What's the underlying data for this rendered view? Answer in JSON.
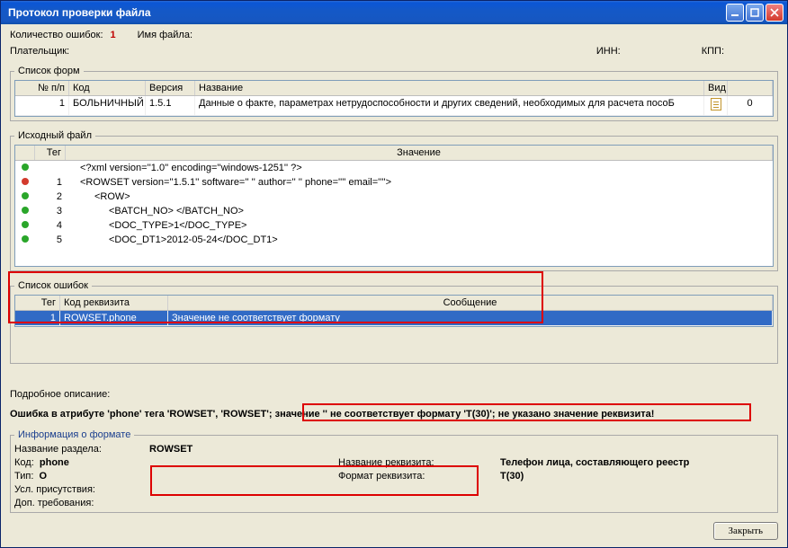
{
  "window": {
    "title": "Протокол проверки файла"
  },
  "summary": {
    "error_count_label": "Количество ошибок:",
    "error_count": "1",
    "file_name_label": "Имя файла:",
    "payer_label": "Плательщик:",
    "inn_label": "ИНН:",
    "kpp_label": "КПП:"
  },
  "forms": {
    "legend": "Список форм",
    "headers": {
      "num": "№ п/п",
      "code": "Код",
      "version": "Версия",
      "name": "Название",
      "vid": "Вид",
      "cnt": ""
    },
    "rows": [
      {
        "num": "1",
        "code": "БОЛЬНИЧНЫЙ",
        "version": "1.5.1",
        "name": "Данные о факте, параметрах нетрудоспособности и других сведений, необходимых для расчета посоБ",
        "cnt": "0"
      }
    ]
  },
  "source": {
    "legend": "Исходный файл",
    "headers": {
      "tag": "Тег",
      "value": "Значение"
    },
    "rows": [
      {
        "status": "green",
        "num": "",
        "text": "<?xml version=''1.0'' encoding=''windows-1251'' ?>",
        "indent": 1
      },
      {
        "status": "red",
        "num": "1",
        "text": "<ROWSET version=''1.5.1'' software=''                   '' author=''                                                   '' phone='''' email=''''>",
        "indent": 1
      },
      {
        "status": "green",
        "num": "2",
        "text": "<ROW>",
        "indent": 2
      },
      {
        "status": "green",
        "num": "3",
        "text": "<BATCH_NO>                                                </BATCH_NO>",
        "indent": 3
      },
      {
        "status": "green",
        "num": "4",
        "text": "<DOC_TYPE>1</DOC_TYPE>",
        "indent": 3
      },
      {
        "status": "green",
        "num": "5",
        "text": "<DOC_DT1>2012-05-24</DOC_DT1>",
        "indent": 3
      }
    ]
  },
  "errors": {
    "legend": "Список ошибок",
    "headers": {
      "tag": "Тег",
      "req": "Код реквизита",
      "msg": "Сообщение"
    },
    "rows": [
      {
        "tag": "1",
        "req": "ROWSET.phone",
        "msg": "Значение не соответствует формату"
      }
    ]
  },
  "detail": {
    "label": "Подробное описание:",
    "prefix": "Ошибка в атрибуте 'phone' тега 'ROWSET', 'ROWSET'; ",
    "highlight": "значение '' не соответствует формату 'T(30)'; не указано значение реквизита!"
  },
  "format_info": {
    "legend": "Информация о формате",
    "section_label": "Название раздела:",
    "section_value": "ROWSET",
    "code_label": "Код:",
    "code_value": "phone",
    "req_name_label": "Название реквизита:",
    "req_name_value": "Телефон лица, составляющего реестр",
    "type_label": "Тип:",
    "type_value": "O",
    "req_fmt_label": "Формат реквизита:",
    "req_fmt_value": "T(30)",
    "presence_label": "Усл. присутствия:",
    "extra_label": "Доп. требования:"
  },
  "footer": {
    "close": "Закрыть"
  }
}
